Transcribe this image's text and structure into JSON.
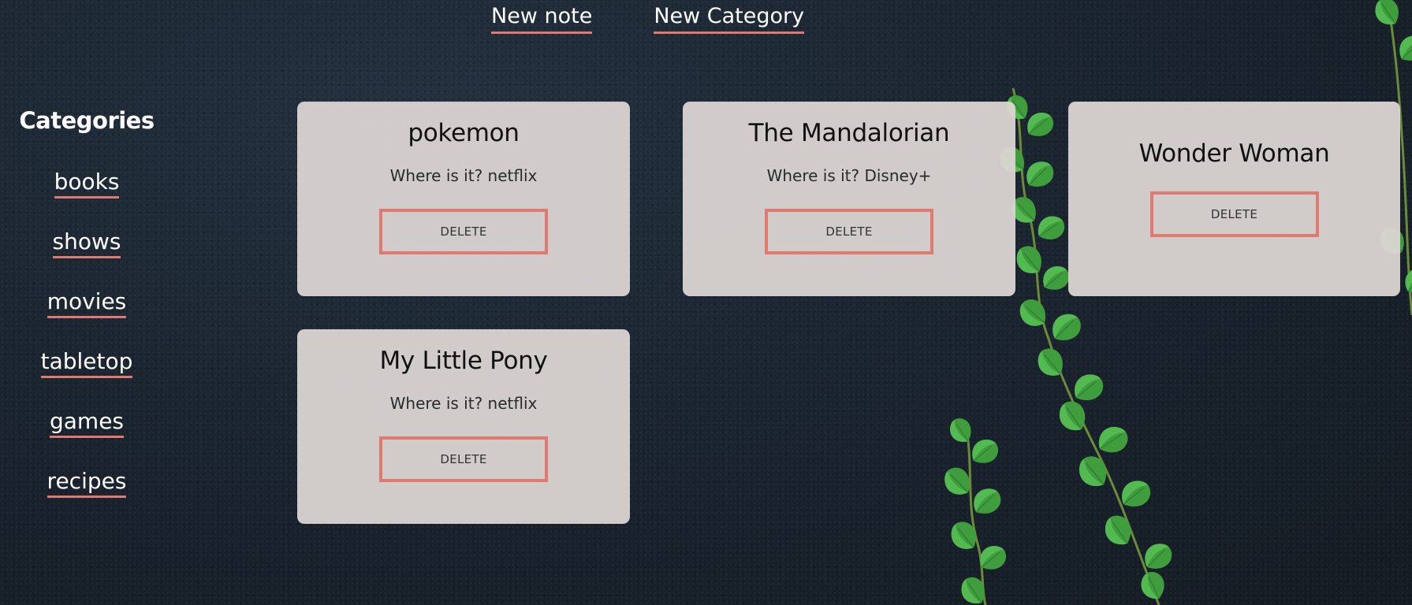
{
  "topnav": {
    "new_note": "New note",
    "new_category": "New Category"
  },
  "sidebar": {
    "title": "Categories",
    "items": [
      {
        "label": "books"
      },
      {
        "label": "shows"
      },
      {
        "label": "movies"
      },
      {
        "label": "tabletop"
      },
      {
        "label": "games"
      },
      {
        "label": "recipes"
      }
    ]
  },
  "notes": [
    {
      "title": "pokemon",
      "location": "Where is it? netflix",
      "delete_label": "DELETE"
    },
    {
      "title": "The Mandalorian",
      "location": "Where is it? Disney+",
      "delete_label": "DELETE"
    },
    {
      "title": "Wonder Woman",
      "delete_label": "DELETE"
    },
    {
      "title": "My Little Pony",
      "location": "Where is it? netflix",
      "delete_label": "DELETE"
    }
  ],
  "colors": {
    "accent": "#e07a70",
    "card_bg": "#dbd5d3",
    "background": "#1a232d",
    "leaf": "#4caf50"
  }
}
